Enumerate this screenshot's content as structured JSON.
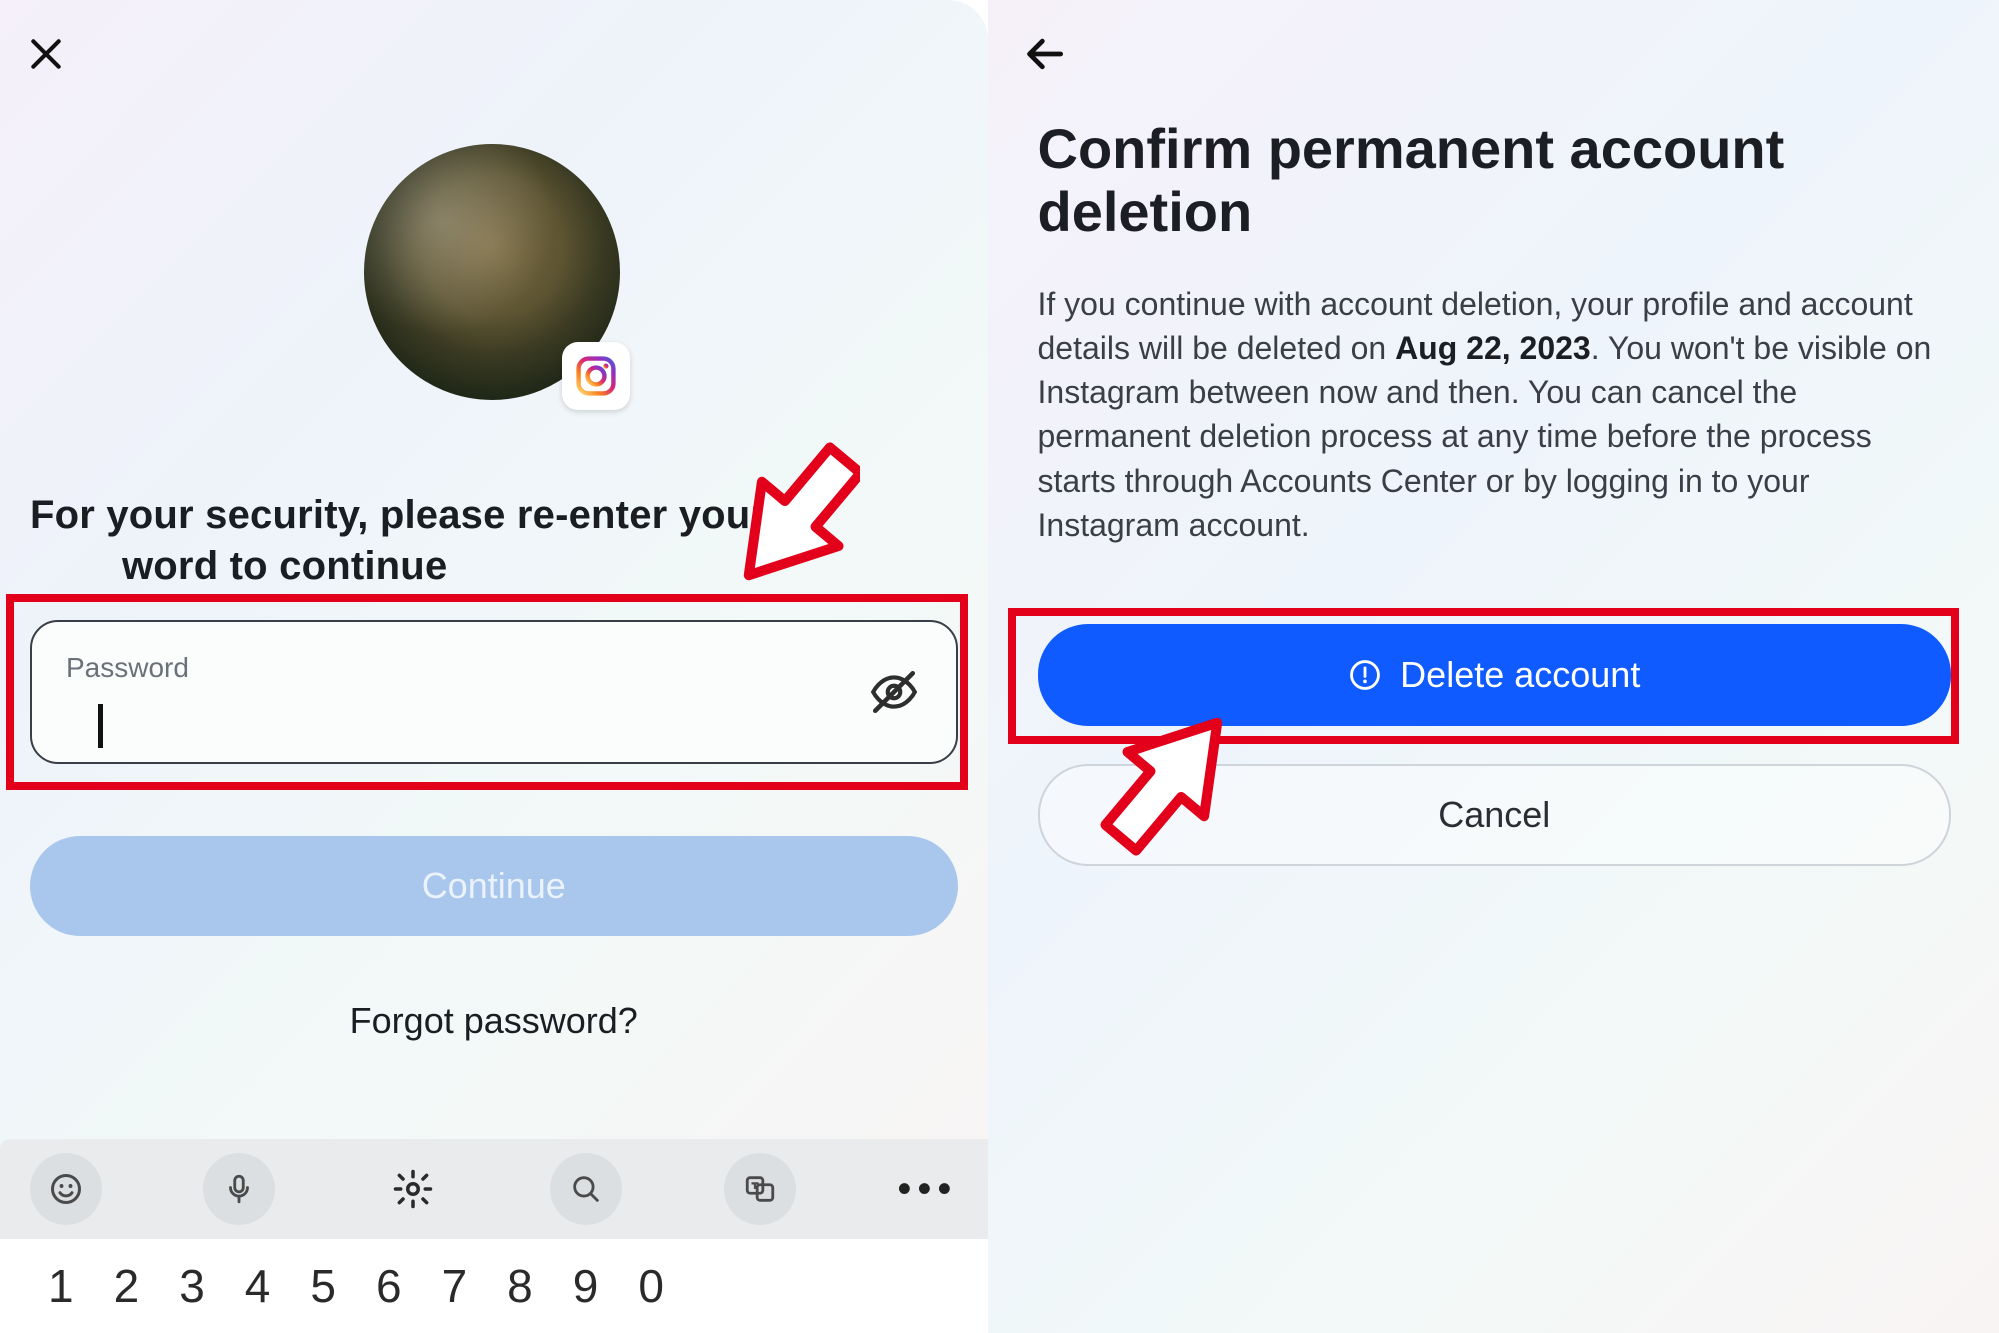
{
  "left": {
    "avatar_platform_icon": "instagram-icon",
    "heading_pre": "For your security, please re-enter your ",
    "heading_obscured": "word",
    "heading_post": " to continue",
    "password_label": "Password",
    "password_value": "",
    "continue_label": "Continue",
    "forgot_label": "Forgot password?",
    "keyboard_toolbar_icons": [
      "emoji-icon",
      "mic-icon",
      "gear-icon",
      "search-icon",
      "translate-icon",
      "more-icon"
    ],
    "number_row": [
      "1",
      "2",
      "3",
      "4",
      "5",
      "6",
      "7",
      "8",
      "9",
      "0"
    ]
  },
  "right": {
    "title": "Confirm permanent account deletion",
    "body_pre": "If you continue with account deletion, your profile and account details will be deleted on ",
    "body_date": "Aug 22, 2023",
    "body_post": ". You won't be visible on Instagram between now and then. You can cancel the permanent deletion process at any time before the process starts through Accounts Center or by logging in to your Instagram account.",
    "delete_label": "Delete account",
    "cancel_label": "Cancel"
  },
  "annotation": {
    "highlight_color": "#e2001a"
  }
}
